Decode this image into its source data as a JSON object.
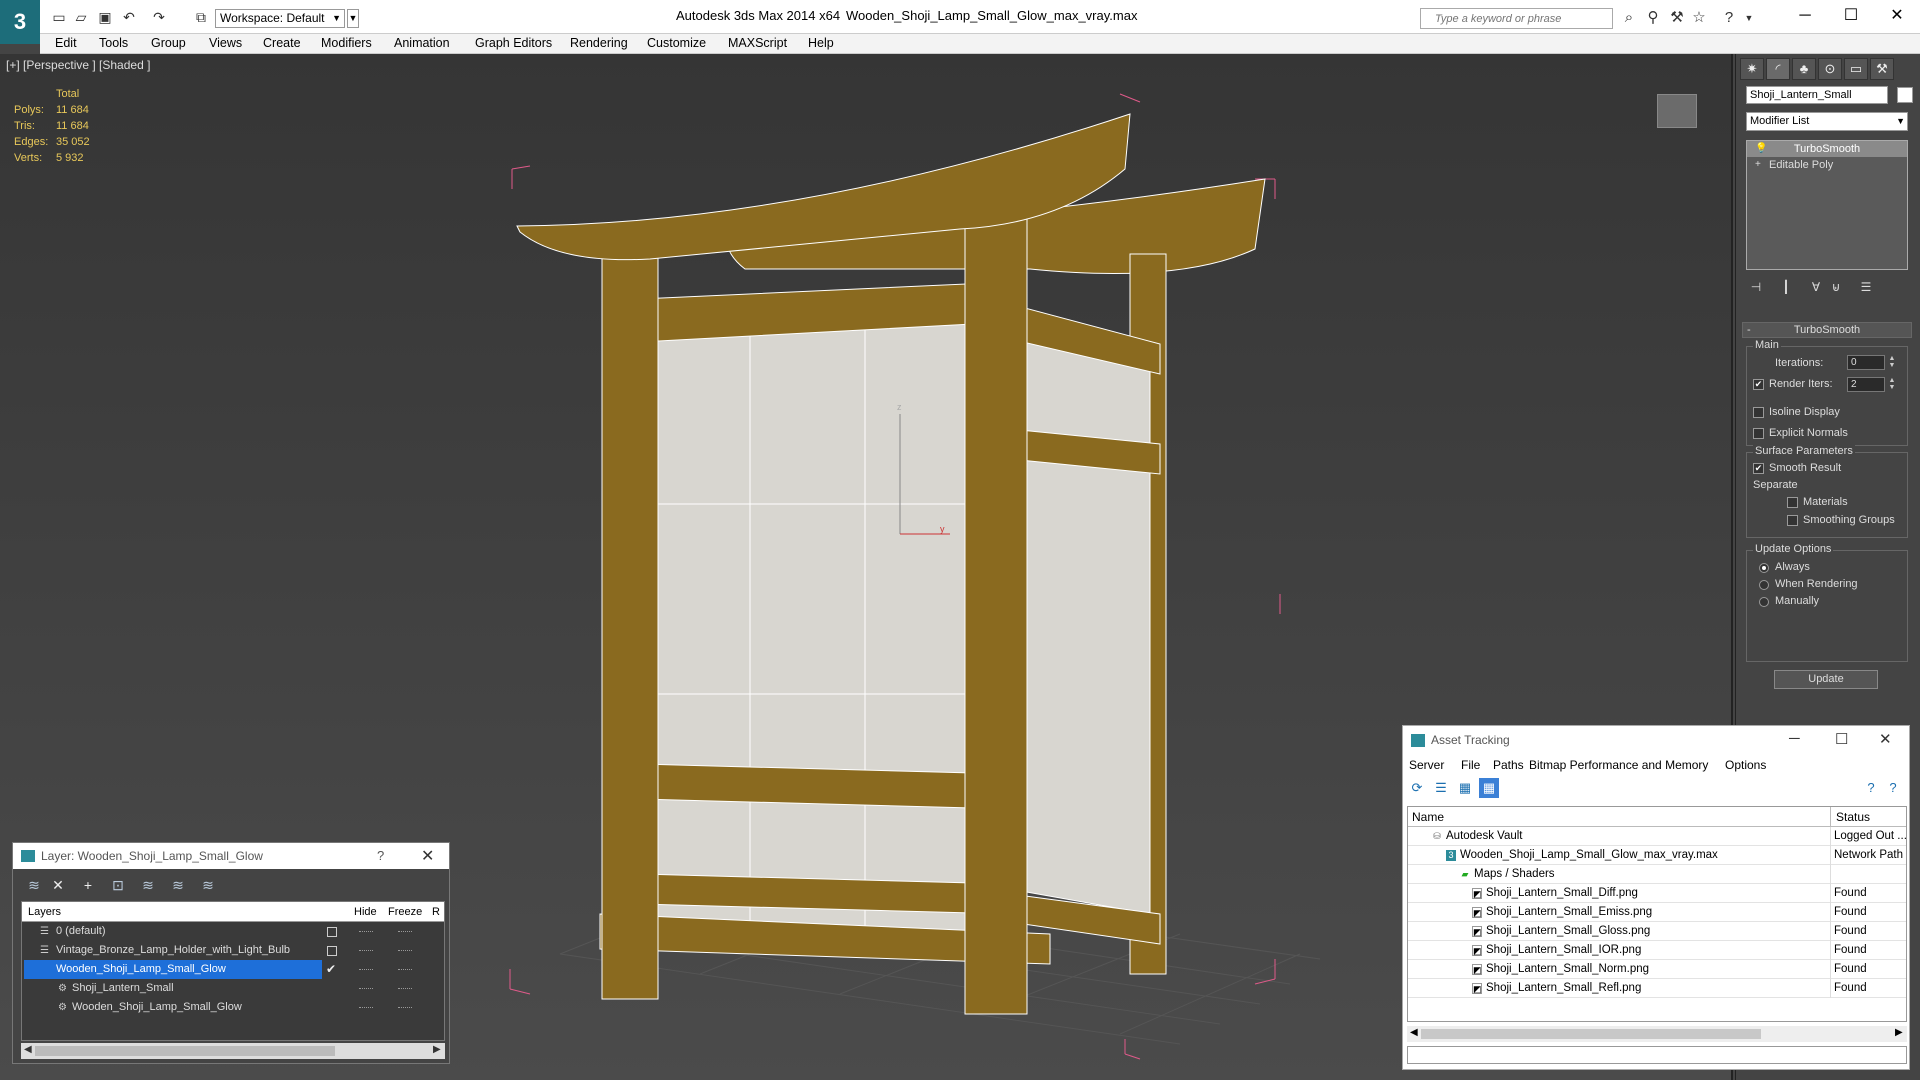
{
  "titlebar": {
    "workspace_label": "Workspace: Default",
    "app_title": "Autodesk 3ds Max  2014 x64",
    "file_title": "Wooden_Shoji_Lamp_Small_Glow_max_vray.max",
    "search_placeholder": "Type a keyword or phrase"
  },
  "menu": [
    "Edit",
    "Tools",
    "Group",
    "Views",
    "Create",
    "Modifiers",
    "Animation",
    "Graph Editors",
    "Rendering",
    "Customize",
    "MAXScript",
    "Help"
  ],
  "viewport": {
    "label": "[+] [Perspective ] [Shaded ]",
    "stats": {
      "total_label": "Total",
      "rows": [
        {
          "label": "Polys:",
          "value": "11 684"
        },
        {
          "label": "Tris:",
          "value": "11 684"
        },
        {
          "label": "Edges:",
          "value": "35 052"
        },
        {
          "label": "Verts:",
          "value": "5 932"
        }
      ]
    },
    "axis_z": "z",
    "axis_y": "y"
  },
  "command_panel": {
    "object_name": "Shoji_Lantern_Small",
    "modifier_list": "Modifier List",
    "stack": [
      "TurboSmooth",
      "Editable Poly"
    ],
    "rollout_title": "TurboSmooth",
    "main_label": "Main",
    "iterations_label": "Iterations:",
    "iterations_value": "0",
    "render_iters_label": "Render Iters:",
    "render_iters_value": "2",
    "isoline_label": "Isoline Display",
    "explicit_normals_label": "Explicit Normals",
    "surface_params_label": "Surface Parameters",
    "smooth_result_label": "Smooth Result",
    "separate_label": "Separate",
    "materials_label": "Materials",
    "smoothing_groups_label": "Smoothing Groups",
    "update_options_label": "Update Options",
    "always_label": "Always",
    "when_rendering_label": "When Rendering",
    "manually_label": "Manually",
    "update_button": "Update"
  },
  "layer_dialog": {
    "title": "Layer: Wooden_Shoji_Lamp_Small_Glow",
    "help": "?",
    "columns": {
      "layers": "Layers",
      "hide": "Hide",
      "freeze": "Freeze",
      "r": "R"
    },
    "rows": [
      {
        "name": "0 (default)"
      },
      {
        "name": "Vintage_Bronze_Lamp_Holder_with_Light_Bulb"
      },
      {
        "name": "Wooden_Shoji_Lamp_Small_Glow"
      },
      {
        "name": "Shoji_Lantern_Small"
      },
      {
        "name": "Wooden_Shoji_Lamp_Small_Glow"
      }
    ]
  },
  "asset_dialog": {
    "title": "Asset Tracking",
    "menu": [
      "Server",
      "File",
      "Paths",
      "Bitmap Performance and Memory",
      "Options"
    ],
    "columns": {
      "name": "Name",
      "status": "Status"
    },
    "rows": [
      {
        "name": "Autodesk Vault",
        "status": "Logged Out ..."
      },
      {
        "name": "Wooden_Shoji_Lamp_Small_Glow_max_vray.max",
        "status": "Network Path"
      },
      {
        "name": "Maps / Shaders",
        "status": ""
      },
      {
        "name": "Shoji_Lantern_Small_Diff.png",
        "status": "Found"
      },
      {
        "name": "Shoji_Lantern_Small_Emiss.png",
        "status": "Found"
      },
      {
        "name": "Shoji_Lantern_Small_Gloss.png",
        "status": "Found"
      },
      {
        "name": "Shoji_Lantern_Small_IOR.png",
        "status": "Found"
      },
      {
        "name": "Shoji_Lantern_Small_Norm.png",
        "status": "Found"
      },
      {
        "name": "Shoji_Lantern_Small_Refl.png",
        "status": "Found"
      }
    ]
  }
}
